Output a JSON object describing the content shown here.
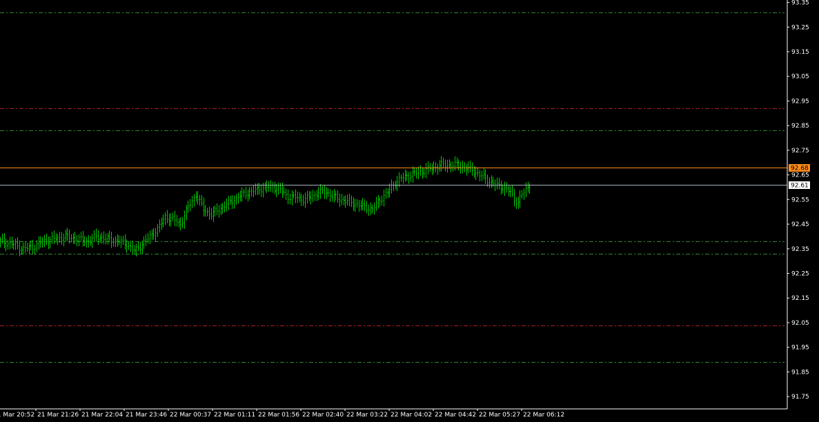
{
  "chart_data": {
    "type": "ohlc",
    "title": "",
    "xlabel": "",
    "ylabel": "",
    "ylim": [
      91.7,
      93.36
    ],
    "grid": false,
    "colors": {
      "background": "#000000",
      "axis": "#ffffff",
      "bars": "#00cc00",
      "ask_line": "#ff8c1a",
      "bid_line": "#a9b3c1",
      "level_green": "#2e8b2e",
      "level_red": "#b02020"
    },
    "y_ticks": [
      "93.35",
      "93.25",
      "93.15",
      "93.05",
      "92.95",
      "92.85",
      "92.75",
      "92.65",
      "92.55",
      "92.45",
      "92.35",
      "92.25",
      "92.15",
      "92.05",
      "91.95",
      "91.85",
      "91.75"
    ],
    "x_ticks": [
      "21 Mar 20:52",
      "21 Mar 21:26",
      "21 Mar 22:04",
      "21 Mar 23:46",
      "22 Mar 00:37",
      "22 Mar 01:11",
      "22 Mar 01:56",
      "22 Mar 02:40",
      "22 Mar 03:22",
      "22 Mar 04:02",
      "22 Mar 04:42",
      "22 Mar 05:27",
      "22 Mar 06:12"
    ],
    "price_tags": {
      "ask": "92.68",
      "bid": "92.61"
    },
    "levels": [
      {
        "value": 93.31,
        "style": "green"
      },
      {
        "value": 92.92,
        "style": "red"
      },
      {
        "value": 92.83,
        "style": "green"
      },
      {
        "value": 92.38,
        "style": "green"
      },
      {
        "value": 92.33,
        "style": "green"
      },
      {
        "value": 92.04,
        "style": "red"
      },
      {
        "value": 91.89,
        "style": "green"
      }
    ],
    "series": [
      {
        "anchors": [
          [
            0,
            92.38
          ],
          [
            6,
            92.37
          ],
          [
            12,
            92.35
          ],
          [
            18,
            92.36
          ],
          [
            22,
            92.38
          ],
          [
            28,
            92.39
          ],
          [
            34,
            92.4
          ],
          [
            40,
            92.39
          ],
          [
            46,
            92.38
          ],
          [
            50,
            92.4
          ],
          [
            56,
            92.39
          ],
          [
            62,
            92.38
          ],
          [
            66,
            92.37
          ],
          [
            70,
            92.34
          ],
          [
            74,
            92.37
          ],
          [
            78,
            92.4
          ],
          [
            82,
            92.43
          ],
          [
            86,
            92.48
          ],
          [
            90,
            92.47
          ],
          [
            94,
            92.45
          ],
          [
            98,
            92.52
          ],
          [
            102,
            92.57
          ],
          [
            106,
            92.51
          ],
          [
            110,
            92.49
          ],
          [
            114,
            92.51
          ],
          [
            118,
            92.53
          ],
          [
            122,
            92.55
          ],
          [
            126,
            92.57
          ],
          [
            130,
            92.58
          ],
          [
            134,
            92.59
          ],
          [
            138,
            92.6
          ],
          [
            142,
            92.6
          ],
          [
            146,
            92.59
          ],
          [
            150,
            92.56
          ],
          [
            154,
            92.56
          ],
          [
            158,
            92.55
          ],
          [
            162,
            92.56
          ],
          [
            166,
            92.58
          ],
          [
            170,
            92.58
          ],
          [
            174,
            92.56
          ],
          [
            178,
            92.55
          ],
          [
            182,
            92.54
          ],
          [
            186,
            92.53
          ],
          [
            190,
            92.52
          ],
          [
            194,
            92.51
          ],
          [
            198,
            92.55
          ],
          [
            202,
            92.58
          ],
          [
            206,
            92.62
          ],
          [
            210,
            92.64
          ],
          [
            214,
            92.65
          ],
          [
            218,
            92.66
          ],
          [
            222,
            92.67
          ],
          [
            226,
            92.68
          ],
          [
            230,
            92.69
          ],
          [
            234,
            92.69
          ],
          [
            238,
            92.69
          ],
          [
            242,
            92.68
          ],
          [
            246,
            92.67
          ],
          [
            250,
            92.65
          ],
          [
            254,
            92.63
          ],
          [
            258,
            92.61
          ],
          [
            262,
            92.6
          ],
          [
            266,
            92.58
          ],
          [
            268,
            92.55
          ],
          [
            270,
            92.54
          ],
          [
            272,
            92.57
          ],
          [
            274,
            92.59
          ],
          [
            276,
            92.61
          ]
        ]
      }
    ]
  }
}
